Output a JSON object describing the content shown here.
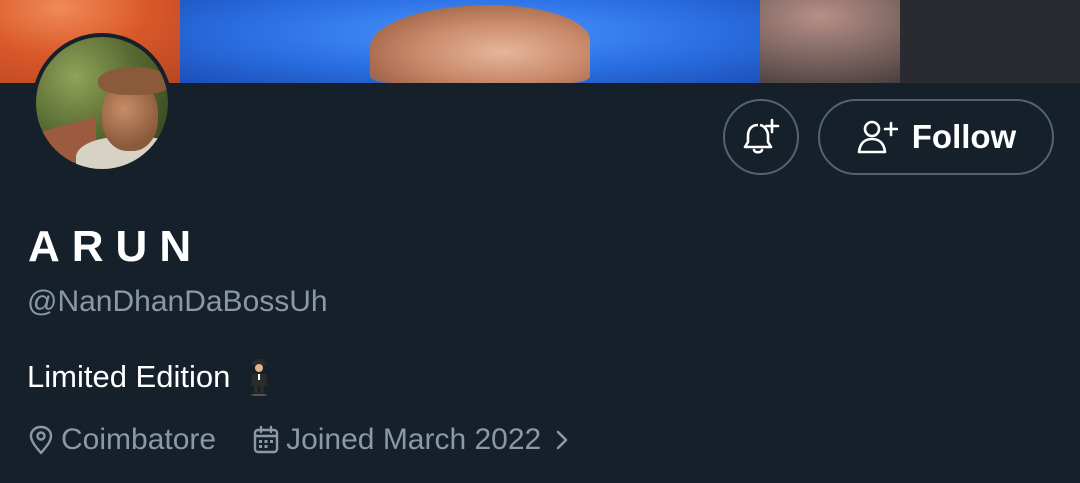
{
  "profile": {
    "display_name": "ARUN",
    "handle": "@NanDhanDaBossUh",
    "bio": "Limited Edition",
    "bio_emoji": "man-in-business-suit-levitating",
    "location": "Coimbatore",
    "joined": "Joined March 2022"
  },
  "actions": {
    "follow_label": "Follow",
    "notify_icon": "bell-plus-icon",
    "follow_icon": "person-add-icon"
  },
  "colors": {
    "background": "#15202b",
    "text_primary": "#ffffff",
    "text_secondary": "#8b98a5",
    "button_border": "#536471"
  }
}
